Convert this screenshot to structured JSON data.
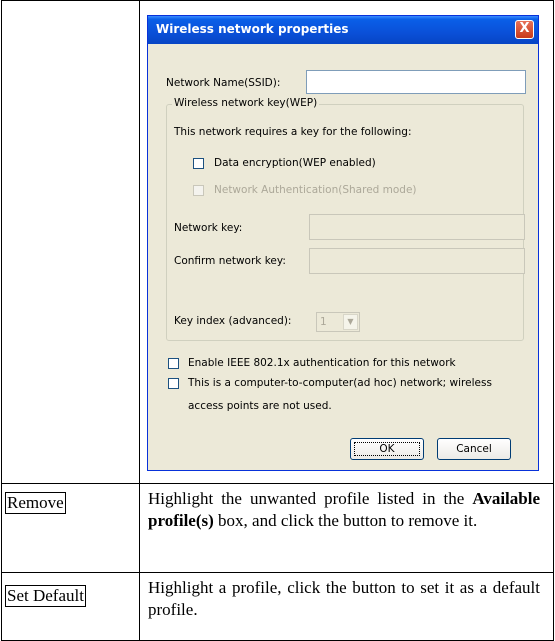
{
  "dialog": {
    "title": "Wireless network properties",
    "close_label": "X",
    "ssid_label": "Network Name(SSID):",
    "ssid_value": "",
    "group_title": "Wireless network key(WEP)",
    "requires_text": "This network requires a key for the following:",
    "data_encryption_label": "Data encryption(WEP enabled)",
    "network_auth_label": "Network Authentication(Shared mode)",
    "network_key_label": "Network key:",
    "confirm_key_label": "Confirm network key:",
    "key_index_label": "Key index (advanced):",
    "key_index_value": "1",
    "ieee_label": "Enable IEEE 802.1x authentication for this network",
    "adhoc_label_line1": "This is a computer-to-computer(ad hoc) network; wireless",
    "adhoc_label_line2": "access points are not used.",
    "ok_label": "OK",
    "cancel_label": "Cancel"
  },
  "rows": [
    {
      "button_label": "Remove",
      "desc_before": "Highlight the unwanted profile listed in the ",
      "desc_bold": "Available profile(s)",
      "desc_after": " box, and click the button to remove it."
    },
    {
      "button_label": "Set Default",
      "desc_text": "Highlight a profile, click the button to set it as a default profile."
    }
  ]
}
